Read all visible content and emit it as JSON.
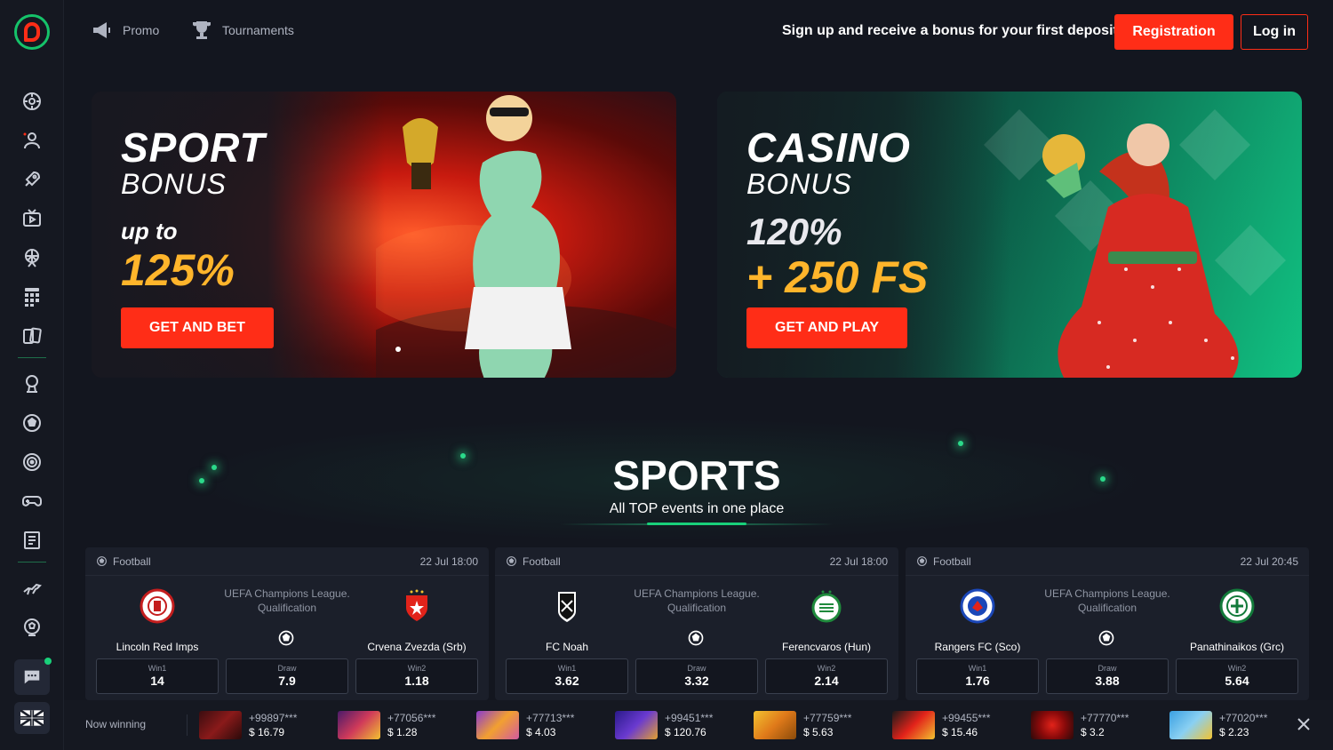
{
  "header": {
    "nav": [
      {
        "label": "Promo",
        "icon": "megaphone-icon"
      },
      {
        "label": "Tournaments",
        "icon": "trophy-icon"
      }
    ],
    "promo_text": "Sign up and receive a bonus for your first deposit",
    "register_label": "Registration",
    "login_label": "Log in"
  },
  "sidebar": {
    "icons": [
      "roulette-icon",
      "dealer-icon",
      "rocket-icon",
      "tv-icon",
      "ferris-wheel-icon",
      "bingo-icon",
      "cards-icon",
      "esports-icon",
      "football-icon",
      "target-icon",
      "gamepad-icon",
      "ticket-icon",
      "horse-racing-icon",
      "virtual-football-icon"
    ],
    "chat": "chat-icon",
    "language": "uk-flag-icon"
  },
  "banners": {
    "sport": {
      "title": "SPORT",
      "subtitle": "BONUS",
      "up_to": "up to",
      "amount": "125%",
      "button": "GET AND BET"
    },
    "casino": {
      "title": "CASINO",
      "subtitle": "BONUS",
      "percent": "120%",
      "free_spins": "+ 250 FS",
      "button": "GET AND PLAY"
    }
  },
  "sports": {
    "title": "SPORTS",
    "subtitle": "All TOP events in one place"
  },
  "events": [
    {
      "sport": "Football",
      "datetime": "22 Jul 18:00",
      "league": "UEFA Champions League. Qualification",
      "home": "Lincoln Red Imps",
      "away": "Crvena Zvezda (Srb)",
      "odds": [
        {
          "label": "Win1",
          "value": "14"
        },
        {
          "label": "Draw",
          "value": "7.9"
        },
        {
          "label": "Win2",
          "value": "1.18"
        }
      ]
    },
    {
      "sport": "Football",
      "datetime": "22 Jul 18:00",
      "league": "UEFA Champions League. Qualification",
      "home": "FC Noah",
      "away": "Ferencvaros (Hun)",
      "odds": [
        {
          "label": "Win1",
          "value": "3.62"
        },
        {
          "label": "Draw",
          "value": "3.32"
        },
        {
          "label": "Win2",
          "value": "2.14"
        }
      ]
    },
    {
      "sport": "Football",
      "datetime": "22 Jul 20:45",
      "league": "UEFA Champions League. Qualification",
      "home": "Rangers FC (Sco)",
      "away": "Panathinaikos (Grc)",
      "odds": [
        {
          "label": "Win1",
          "value": "1.76"
        },
        {
          "label": "Draw",
          "value": "3.88"
        },
        {
          "label": "Win2",
          "value": "5.64"
        }
      ]
    }
  ],
  "winners": {
    "label": "Now winning",
    "items": [
      {
        "user": "+99897***",
        "amount": "$ 16.79"
      },
      {
        "user": "+77056***",
        "amount": "$ 1.28"
      },
      {
        "user": "+77713***",
        "amount": "$ 4.03"
      },
      {
        "user": "+99451***",
        "amount": "$ 120.76"
      },
      {
        "user": "+77759***",
        "amount": "$ 5.63"
      },
      {
        "user": "+99455***",
        "amount": "$ 15.46"
      },
      {
        "user": "+77770***",
        "amount": "$ 3.2"
      },
      {
        "user": "+77020***",
        "amount": "$ 2.23"
      }
    ]
  },
  "colors": {
    "accent": "#ff2d17",
    "brand_green": "#19d07a",
    "gold": "#ffb52b",
    "background": "#13161f"
  }
}
